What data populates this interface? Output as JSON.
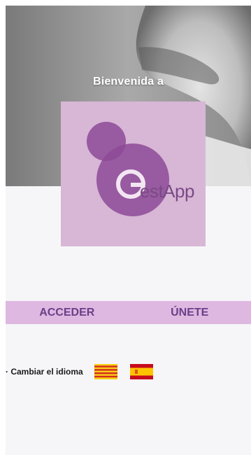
{
  "hero": {
    "welcome_text": "Bienvenida a"
  },
  "logo": {
    "letter": "G",
    "wordmark": "estApp",
    "color_circles": "#9c5aa6",
    "color_card": "#d8b6d6"
  },
  "actions": {
    "login_label": "ACCEDER",
    "join_label": "ÚNETE",
    "bar_color": "#dfb8e2",
    "text_color": "#6a3f87"
  },
  "language": {
    "label": "· Cambiar el idioma",
    "flags": [
      {
        "name": "catalan-flag-icon",
        "colors": [
          "#f7d117",
          "#d52b1e"
        ]
      },
      {
        "name": "spanish-flag-icon",
        "colors": [
          "#c60b1e",
          "#ffc400"
        ]
      }
    ]
  }
}
